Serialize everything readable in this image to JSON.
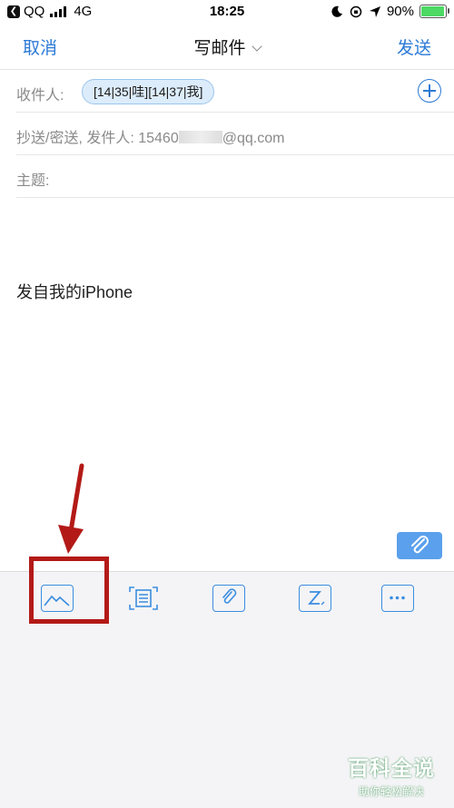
{
  "status_bar": {
    "back_app": "QQ",
    "network": "4G",
    "time": "18:25",
    "battery_percent": "90%",
    "battery_level": 0.9
  },
  "nav": {
    "cancel_label": "取消",
    "title": "写邮件",
    "send_label": "发送"
  },
  "compose": {
    "to_label": "收件人:",
    "recipient_chip": "[14|35|哇][14|37|我]",
    "cc_label": "抄送/密送, 发件人: ",
    "sender_prefix": "15460",
    "sender_suffix": "@qq.com",
    "subject_label": "主题:",
    "signature": "发自我的iPhone"
  },
  "toolbar": {
    "icons": [
      "image-icon",
      "scan-icon",
      "attachment-icon",
      "format-text-icon",
      "more-icon"
    ]
  },
  "colors": {
    "accent": "#2c7ad6",
    "annotation_red": "#b31a17",
    "toolbar_bg": "#f4f4f6"
  },
  "watermark": {
    "title": "百科全说",
    "subtitle": "助你轻松解决"
  }
}
